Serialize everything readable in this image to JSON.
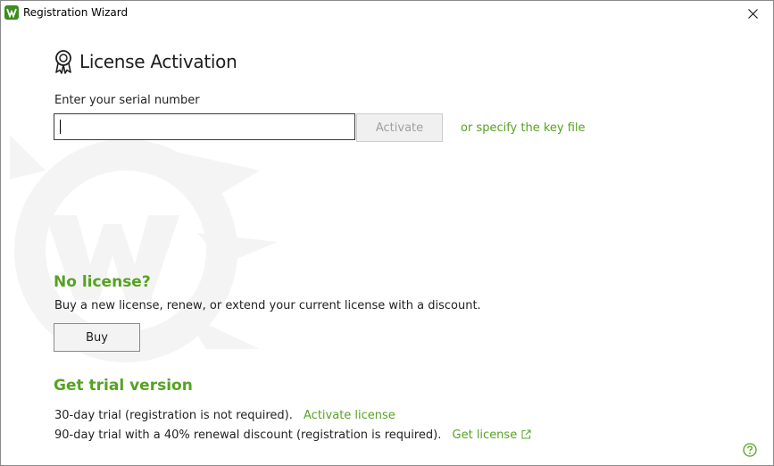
{
  "window": {
    "title": "Registration Wizard"
  },
  "colors": {
    "accent": "#55a322",
    "text": "#1e1e1e",
    "watermark": "#f4f4f4"
  },
  "icons": {
    "app": "drweb-spider-icon",
    "close": "close-icon",
    "award": "award-ribbon-icon",
    "external": "external-link-icon",
    "help": "help-icon"
  },
  "main": {
    "heading": "License Activation",
    "serial_label": "Enter your serial number",
    "serial_value": "",
    "activate_label": "Activate",
    "key_file_link": "or specify the key file"
  },
  "no_license": {
    "title": "No license?",
    "description": "Buy a new license, renew, or extend your current license with a discount.",
    "buy_label": "Buy"
  },
  "trial": {
    "title": "Get trial version",
    "row1_text": "30-day trial (registration is not required).",
    "row1_link": "Activate license",
    "row2_text": "90-day trial with a 40% renewal discount (registration is required).",
    "row2_link": "Get license"
  }
}
